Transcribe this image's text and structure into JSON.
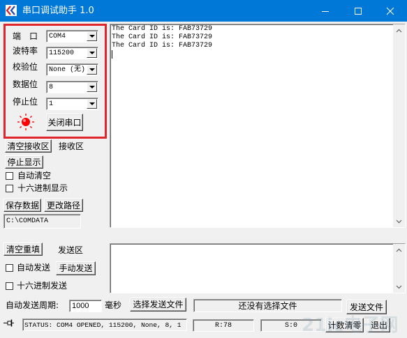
{
  "window": {
    "title": "串口调试助手 1.0",
    "accent": "#0078d7"
  },
  "settings": {
    "port": {
      "label": "端　口",
      "value": "COM4"
    },
    "baud": {
      "label": "波特率",
      "value": "115200"
    },
    "parity": {
      "label": "校验位",
      "value": "None (无)"
    },
    "databits": {
      "label": "数据位",
      "value": "8"
    },
    "stopbits": {
      "label": "停止位",
      "value": "1"
    },
    "led_color": "#ff0000",
    "highlight_color": "#e0262c",
    "toggle_label": "关闭串口"
  },
  "receive": {
    "clear_label": "清空接收区",
    "area_label": "接收区",
    "stop_label": "停止显示",
    "auto_clear": {
      "label": "自动清空",
      "checked": false
    },
    "hex_display": {
      "label": "十六进制显示",
      "checked": false
    },
    "save_label": "保存数据",
    "change_path_label": "更改路径",
    "path": "C:\\COMDATA",
    "lines": [
      "The Card ID is: FAB73729",
      "The Card ID is: FAB73729",
      "The Card ID is: FAB73729"
    ]
  },
  "send": {
    "clear_label": "清空重填",
    "area_label": "发送区",
    "auto_send": {
      "label": "自动发送",
      "checked": false
    },
    "manual_label": "手动发送",
    "hex_send": {
      "label": "十六进制发送",
      "checked": false
    },
    "period_label": "自动发送周期:",
    "period_value": "1000",
    "period_unit": "毫秒",
    "choose_file_label": "选择发送文件",
    "file_status": "还没有选择文件",
    "send_file_label": "发送文件"
  },
  "statusbar": {
    "status": "STATUS: COM4 OPENED, 115200, None, 8, 1",
    "rx": "R:78",
    "tx": "S:0",
    "reset_label": "计数清零",
    "exit_label": "退出"
  },
  "watermark": "21ic电子网"
}
